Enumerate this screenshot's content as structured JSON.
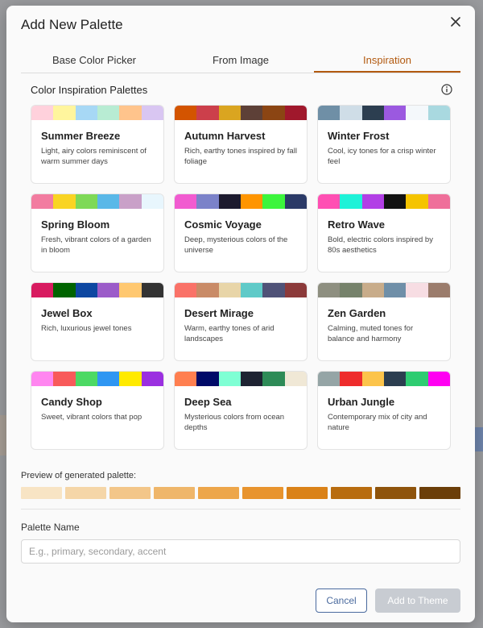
{
  "dialog": {
    "title": "Add New Palette"
  },
  "tabs": [
    {
      "label": "Base Color Picker"
    },
    {
      "label": "From Image"
    },
    {
      "label": "Inspiration"
    }
  ],
  "inspiration": {
    "section_title": "Color Inspiration Palettes",
    "palettes": [
      {
        "name": "Summer Breeze",
        "description": "Light, airy colors reminiscent of warm summer days",
        "colors": [
          "#ffd1dc",
          "#fff59d",
          "#a7d8f5",
          "#b8ecd3",
          "#ffc48c",
          "#d9c6f2"
        ]
      },
      {
        "name": "Autumn Harvest",
        "description": "Rich, earthy tones inspired by fall foliage",
        "colors": [
          "#d35400",
          "#cc3f4b",
          "#daa520",
          "#5d4037",
          "#8b4513",
          "#a0182c"
        ]
      },
      {
        "name": "Winter Frost",
        "description": "Cool, icy tones for a crisp winter feel",
        "colors": [
          "#6f8fa6",
          "#cfdde7",
          "#2c3e50",
          "#9b59e0",
          "#f4f8fb",
          "#a9d9e0"
        ]
      },
      {
        "name": "Spring Bloom",
        "description": "Fresh, vibrant colors of a garden in bloom",
        "colors": [
          "#f27ca0",
          "#f9d423",
          "#7ed957",
          "#5ab8e8",
          "#c9a0c8",
          "#e8f6fd"
        ]
      },
      {
        "name": "Cosmic Voyage",
        "description": "Deep, mysterious colors of the universe",
        "colors": [
          "#f15bd0",
          "#7b82c9",
          "#1c1a2e",
          "#ff9500",
          "#3cf53c",
          "#2b3a67"
        ]
      },
      {
        "name": "Retro Wave",
        "description": "Bold, electric colors inspired by 80s aesthetics",
        "colors": [
          "#ff4fb3",
          "#1ef2d8",
          "#b23fe6",
          "#121212",
          "#f5c400",
          "#ef6f9a"
        ]
      },
      {
        "name": "Jewel Box",
        "description": "Rich, luxurious jewel tones",
        "colors": [
          "#d81b60",
          "#006400",
          "#0d47a1",
          "#9c5cc9",
          "#ffc870",
          "#333333"
        ]
      },
      {
        "name": "Desert Mirage",
        "description": "Warm, earthy tones of arid landscapes",
        "colors": [
          "#fa7268",
          "#c98b67",
          "#e8d5a8",
          "#5fcac8",
          "#4f5277",
          "#8c3a3a"
        ]
      },
      {
        "name": "Zen Garden",
        "description": "Calming, muted tones for balance and harmony",
        "colors": [
          "#8e8f80",
          "#76826b",
          "#c8ac8a",
          "#6f8fa8",
          "#f7dde3",
          "#9b7c6c"
        ]
      },
      {
        "name": "Candy Shop",
        "description": "Sweet, vibrant colors that pop",
        "colors": [
          "#ff86f0",
          "#f85a5a",
          "#4cd964",
          "#2f96f2",
          "#ffea00",
          "#9b30e0"
        ]
      },
      {
        "name": "Deep Sea",
        "description": "Mysterious colors from ocean depths",
        "colors": [
          "#ff7f50",
          "#000a68",
          "#7fffd4",
          "#1e2332",
          "#2e8b57",
          "#f0e8d6"
        ]
      },
      {
        "name": "Urban Jungle",
        "description": "Contemporary mix of city and nature",
        "colors": [
          "#95a5a6",
          "#ee2c2c",
          "#fcc44b",
          "#2c3e50",
          "#2ecc71",
          "#ff00f2"
        ]
      }
    ]
  },
  "preview": {
    "label": "Preview of generated palette:",
    "colors": [
      "#f8e4c4",
      "#f5d6a8",
      "#f3c689",
      "#efb66a",
      "#eda64a",
      "#e8942e",
      "#da8218",
      "#b86c0f",
      "#8f540c",
      "#6b3e09"
    ]
  },
  "palette_name": {
    "label": "Palette Name",
    "placeholder": "E.g., primary, secondary, accent",
    "value": ""
  },
  "actions": {
    "cancel_label": "Cancel",
    "add_label": "Add to Theme"
  },
  "icons": {
    "close": "close-icon",
    "info": "info-icon"
  }
}
